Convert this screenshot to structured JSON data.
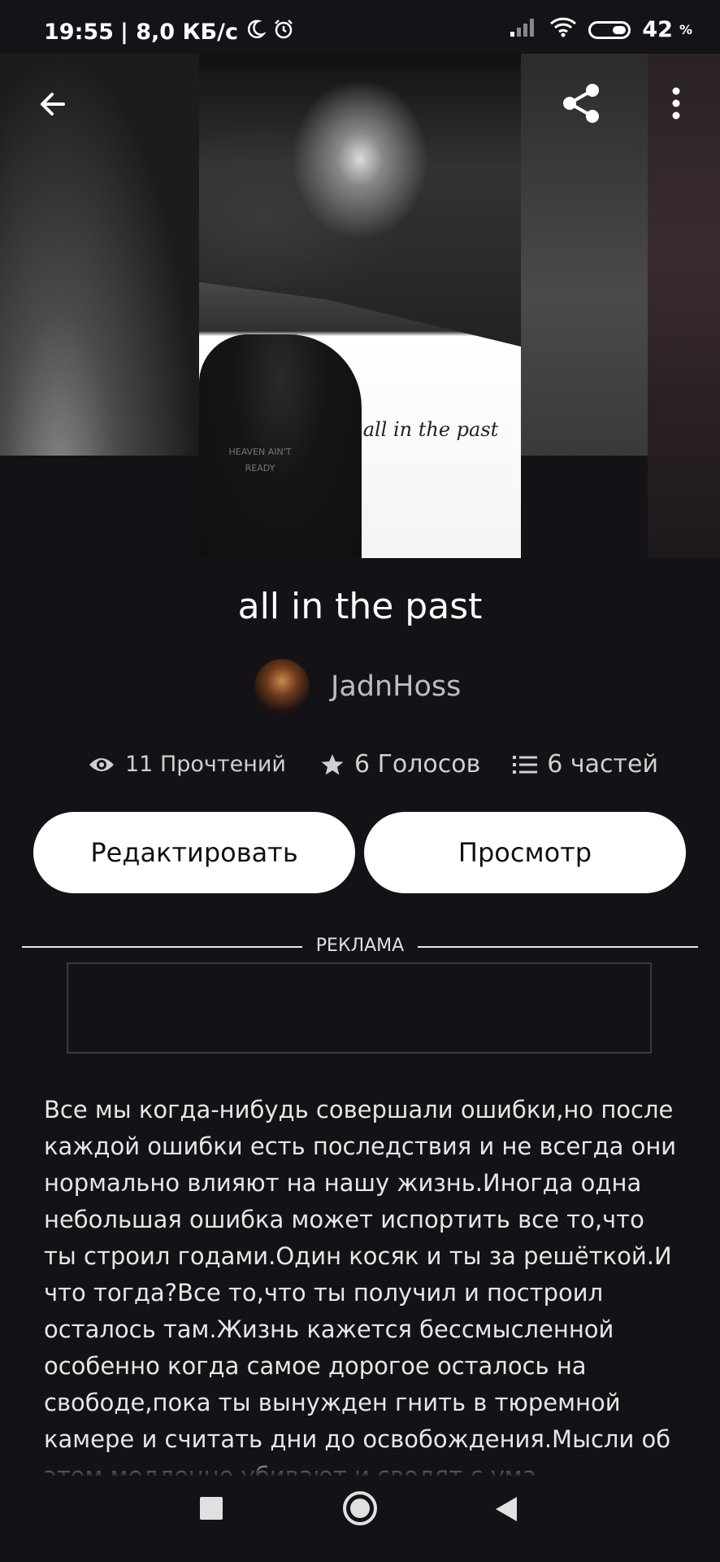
{
  "status_bar": {
    "time": "19:55",
    "net_speed": "| 8,0 КБ/с",
    "battery_level": "42",
    "battery_unit": "%"
  },
  "header": {
    "back_icon": "arrow-left-icon",
    "share_icon": "share-icon",
    "more_icon": "more-vertical-icon"
  },
  "cover": {
    "cover_text": "all in the past",
    "shirt_text": "HEAVEN AIN'T READY"
  },
  "book": {
    "title": "all in the past",
    "author": "JadnHoss"
  },
  "stats": {
    "reads": "11 Прочтений",
    "votes": "6 Голосов",
    "parts": "6 частей"
  },
  "actions": {
    "edit_label": "Редактировать",
    "preview_label": "Просмотр"
  },
  "ad": {
    "label": "РЕКЛАМА"
  },
  "description": {
    "text": "Все мы когда-нибудь совершали ошибки,но после каждой ошибки есть  последствия и не всегда они нормально влияют на нашу жизнь.Иногда одна небольшая ошибка может испортить все то,что ты строил годами.Один косяк и ты за решёткой.И что тогда?Все то,что ты получил и построил осталось там.Жизнь кажется бессмысленной особенно когда самое дорогое осталось на свободе,пока ты вынужден гнить в тюремной камере и считать дни до освобождения.Мысли об этом медленно убивают и сводят с ума..."
  },
  "colors": {
    "background": "#141216",
    "button_bg": "#ffffff",
    "muted_text": "#bdbdbd"
  }
}
